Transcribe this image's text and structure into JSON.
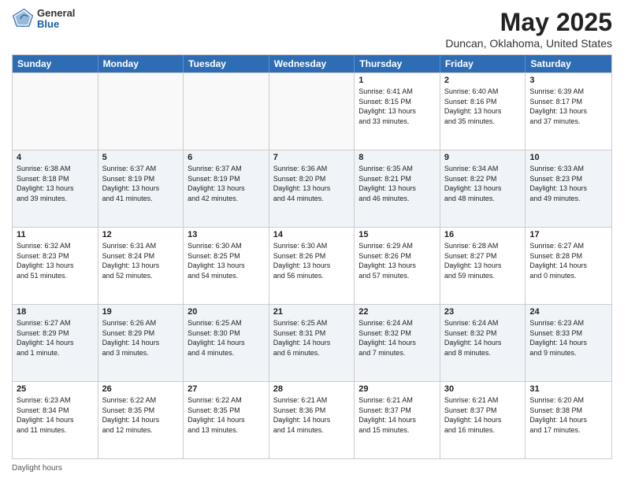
{
  "header": {
    "logo_general": "General",
    "logo_blue": "Blue",
    "title": "May 2025",
    "subtitle": "Duncan, Oklahoma, United States"
  },
  "days_of_week": [
    "Sunday",
    "Monday",
    "Tuesday",
    "Wednesday",
    "Thursday",
    "Friday",
    "Saturday"
  ],
  "legend": "Daylight hours",
  "weeks": [
    [
      {
        "day": "",
        "text": ""
      },
      {
        "day": "",
        "text": ""
      },
      {
        "day": "",
        "text": ""
      },
      {
        "day": "",
        "text": ""
      },
      {
        "day": "1",
        "text": "Sunrise: 6:41 AM\nSunset: 8:15 PM\nDaylight: 13 hours\nand 33 minutes."
      },
      {
        "day": "2",
        "text": "Sunrise: 6:40 AM\nSunset: 8:16 PM\nDaylight: 13 hours\nand 35 minutes."
      },
      {
        "day": "3",
        "text": "Sunrise: 6:39 AM\nSunset: 8:17 PM\nDaylight: 13 hours\nand 37 minutes."
      }
    ],
    [
      {
        "day": "4",
        "text": "Sunrise: 6:38 AM\nSunset: 8:18 PM\nDaylight: 13 hours\nand 39 minutes."
      },
      {
        "day": "5",
        "text": "Sunrise: 6:37 AM\nSunset: 8:19 PM\nDaylight: 13 hours\nand 41 minutes."
      },
      {
        "day": "6",
        "text": "Sunrise: 6:37 AM\nSunset: 8:19 PM\nDaylight: 13 hours\nand 42 minutes."
      },
      {
        "day": "7",
        "text": "Sunrise: 6:36 AM\nSunset: 8:20 PM\nDaylight: 13 hours\nand 44 minutes."
      },
      {
        "day": "8",
        "text": "Sunrise: 6:35 AM\nSunset: 8:21 PM\nDaylight: 13 hours\nand 46 minutes."
      },
      {
        "day": "9",
        "text": "Sunrise: 6:34 AM\nSunset: 8:22 PM\nDaylight: 13 hours\nand 48 minutes."
      },
      {
        "day": "10",
        "text": "Sunrise: 6:33 AM\nSunset: 8:23 PM\nDaylight: 13 hours\nand 49 minutes."
      }
    ],
    [
      {
        "day": "11",
        "text": "Sunrise: 6:32 AM\nSunset: 8:23 PM\nDaylight: 13 hours\nand 51 minutes."
      },
      {
        "day": "12",
        "text": "Sunrise: 6:31 AM\nSunset: 8:24 PM\nDaylight: 13 hours\nand 52 minutes."
      },
      {
        "day": "13",
        "text": "Sunrise: 6:30 AM\nSunset: 8:25 PM\nDaylight: 13 hours\nand 54 minutes."
      },
      {
        "day": "14",
        "text": "Sunrise: 6:30 AM\nSunset: 8:26 PM\nDaylight: 13 hours\nand 56 minutes."
      },
      {
        "day": "15",
        "text": "Sunrise: 6:29 AM\nSunset: 8:26 PM\nDaylight: 13 hours\nand 57 minutes."
      },
      {
        "day": "16",
        "text": "Sunrise: 6:28 AM\nSunset: 8:27 PM\nDaylight: 13 hours\nand 59 minutes."
      },
      {
        "day": "17",
        "text": "Sunrise: 6:27 AM\nSunset: 8:28 PM\nDaylight: 14 hours\nand 0 minutes."
      }
    ],
    [
      {
        "day": "18",
        "text": "Sunrise: 6:27 AM\nSunset: 8:29 PM\nDaylight: 14 hours\nand 1 minute."
      },
      {
        "day": "19",
        "text": "Sunrise: 6:26 AM\nSunset: 8:29 PM\nDaylight: 14 hours\nand 3 minutes."
      },
      {
        "day": "20",
        "text": "Sunrise: 6:25 AM\nSunset: 8:30 PM\nDaylight: 14 hours\nand 4 minutes."
      },
      {
        "day": "21",
        "text": "Sunrise: 6:25 AM\nSunset: 8:31 PM\nDaylight: 14 hours\nand 6 minutes."
      },
      {
        "day": "22",
        "text": "Sunrise: 6:24 AM\nSunset: 8:32 PM\nDaylight: 14 hours\nand 7 minutes."
      },
      {
        "day": "23",
        "text": "Sunrise: 6:24 AM\nSunset: 8:32 PM\nDaylight: 14 hours\nand 8 minutes."
      },
      {
        "day": "24",
        "text": "Sunrise: 6:23 AM\nSunset: 8:33 PM\nDaylight: 14 hours\nand 9 minutes."
      }
    ],
    [
      {
        "day": "25",
        "text": "Sunrise: 6:23 AM\nSunset: 8:34 PM\nDaylight: 14 hours\nand 11 minutes."
      },
      {
        "day": "26",
        "text": "Sunrise: 6:22 AM\nSunset: 8:35 PM\nDaylight: 14 hours\nand 12 minutes."
      },
      {
        "day": "27",
        "text": "Sunrise: 6:22 AM\nSunset: 8:35 PM\nDaylight: 14 hours\nand 13 minutes."
      },
      {
        "day": "28",
        "text": "Sunrise: 6:21 AM\nSunset: 8:36 PM\nDaylight: 14 hours\nand 14 minutes."
      },
      {
        "day": "29",
        "text": "Sunrise: 6:21 AM\nSunset: 8:37 PM\nDaylight: 14 hours\nand 15 minutes."
      },
      {
        "day": "30",
        "text": "Sunrise: 6:21 AM\nSunset: 8:37 PM\nDaylight: 14 hours\nand 16 minutes."
      },
      {
        "day": "31",
        "text": "Sunrise: 6:20 AM\nSunset: 8:38 PM\nDaylight: 14 hours\nand 17 minutes."
      }
    ]
  ]
}
